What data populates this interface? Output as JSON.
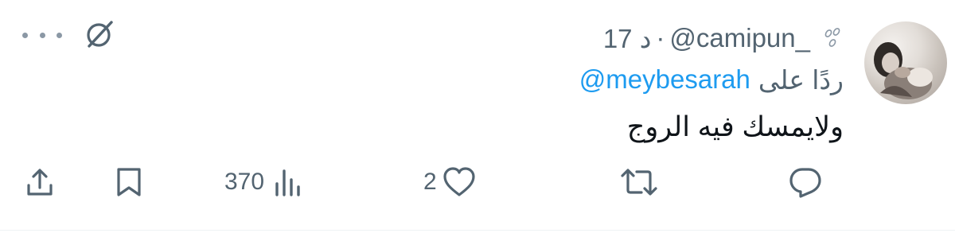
{
  "tweet": {
    "handle": "@camipun_",
    "separator": "·",
    "time": "17 د",
    "reply_prefix": "ردًا على",
    "reply_to": "@meybesarah",
    "text": "ولايمسك فيه الروج"
  },
  "actions": {
    "views_count": "370",
    "likes_count": "2"
  },
  "icons": {
    "more": "more-dots-icon",
    "grok": "grok-icon",
    "share": "share-icon",
    "bookmark": "bookmark-icon",
    "views": "analytics-icon",
    "like": "heart-icon",
    "retweet": "retweet-icon",
    "reply": "reply-icon"
  },
  "colors": {
    "text": "#0f1419",
    "secondary": "#536471",
    "link": "#1d9bf0"
  }
}
